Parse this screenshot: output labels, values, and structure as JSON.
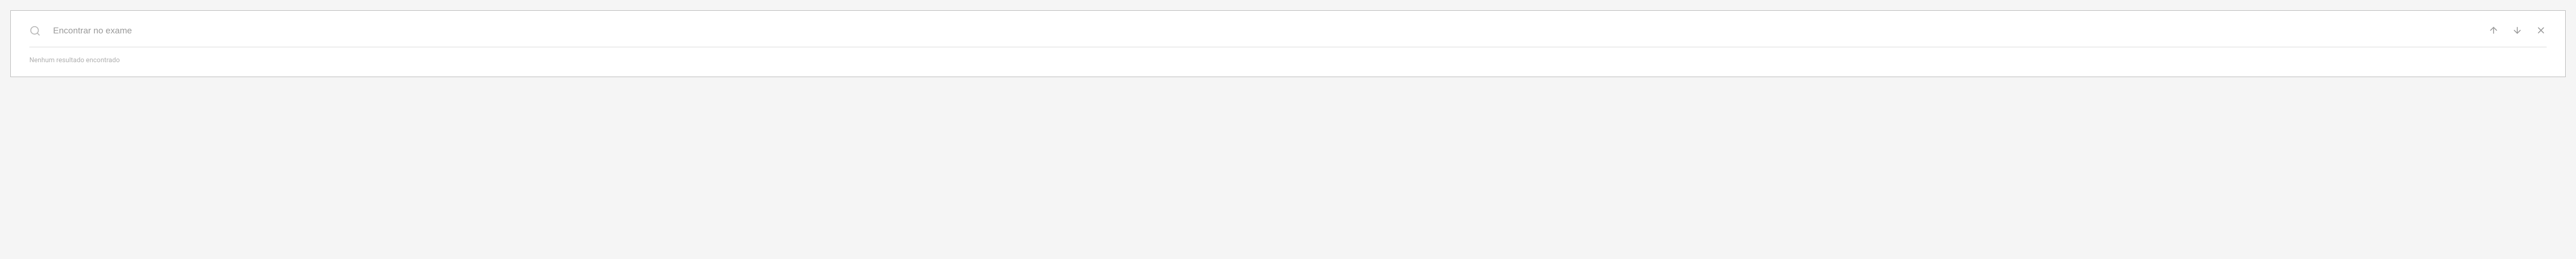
{
  "search": {
    "placeholder": "Encontrar no exame",
    "value": ""
  },
  "status": {
    "message": "Nenhum resultado encontrado"
  }
}
